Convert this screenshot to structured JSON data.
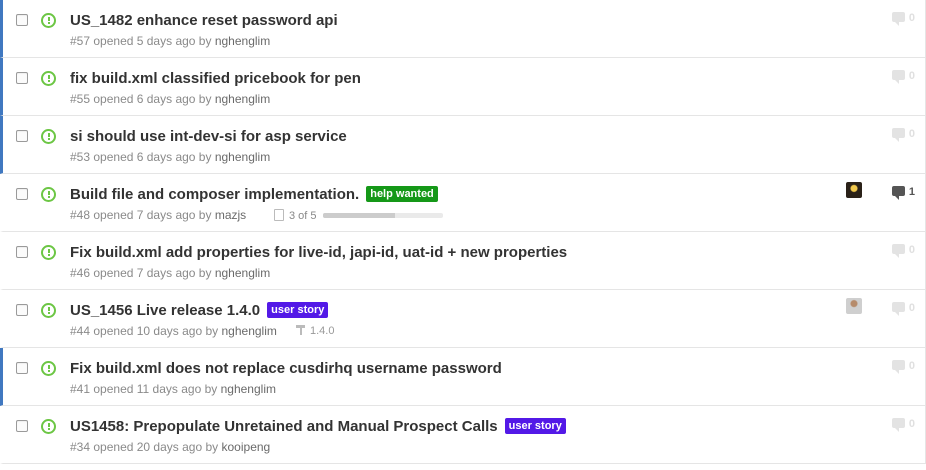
{
  "issues": [
    {
      "title": "US_1482 enhance reset password api",
      "number": "#57",
      "opened": "opened 5 days ago by",
      "author": "nghenglim",
      "comments": "0",
      "unread": true,
      "labels": []
    },
    {
      "title": "fix build.xml classified pricebook for pen",
      "number": "#55",
      "opened": "opened 6 days ago by",
      "author": "nghenglim",
      "comments": "0",
      "unread": true,
      "labels": []
    },
    {
      "title": "si should use int-dev-si for asp service",
      "number": "#53",
      "opened": "opened 6 days ago by",
      "author": "nghenglim",
      "comments": "0",
      "unread": true,
      "labels": []
    },
    {
      "title": "Build file and composer implementation.",
      "number": "#48",
      "opened": "opened 7 days ago by",
      "author": "mazjs",
      "comments": "1",
      "unread": false,
      "labels": [
        {
          "name": "help wanted",
          "color": "#159818"
        }
      ],
      "tasks": "3 of 5",
      "task_progress": 0.6,
      "assignee": "avatar-1"
    },
    {
      "title": "Fix build.xml add properties for live-id, japi-id, uat-id + new properties",
      "number": "#46",
      "opened": "opened 7 days ago by",
      "author": "nghenglim",
      "comments": "0",
      "unread": false,
      "labels": []
    },
    {
      "title": "US_1456 Live release 1.4.0",
      "number": "#44",
      "opened": "opened 10 days ago by",
      "author": "nghenglim",
      "comments": "0",
      "unread": false,
      "labels": [
        {
          "name": "user story",
          "color": "#5319e7"
        }
      ],
      "milestone": "1.4.0",
      "assignee": "avatar-2"
    },
    {
      "title": "Fix build.xml does not replace cusdirhq username password",
      "number": "#41",
      "opened": "opened 11 days ago by",
      "author": "nghenglim",
      "comments": "0",
      "unread": true,
      "labels": []
    },
    {
      "title": "US1458: Prepopulate Unretained and Manual Prospect Calls",
      "number": "#34",
      "opened": "opened 20 days ago by",
      "author": "kooipeng",
      "comments": "0",
      "unread": false,
      "labels": [
        {
          "name": "user story",
          "color": "#5319e7"
        }
      ]
    }
  ]
}
